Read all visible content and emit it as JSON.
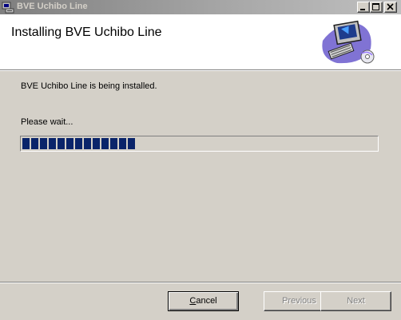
{
  "window": {
    "title": "BVE Uchibo Line"
  },
  "header": {
    "title": "Installing BVE Uchibo Line",
    "graphic_icon": "computer-installer-icon"
  },
  "body": {
    "status_text": "BVE Uchibo Line is being installed.",
    "wait_text": "Please wait...",
    "progress_fraction": 0.32
  },
  "buttons": {
    "cancel": {
      "accel": "C",
      "rest": "ancel",
      "enabled": true
    },
    "previous": {
      "label": "Previous",
      "enabled": false
    },
    "next": {
      "label": "Next",
      "enabled": false
    }
  },
  "colors": {
    "progress": "#0a246a",
    "face": "#d4d0c8"
  }
}
